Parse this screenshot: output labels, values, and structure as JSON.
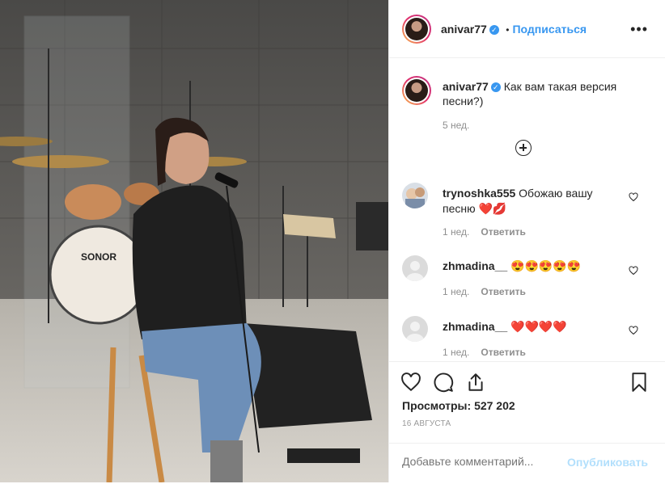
{
  "post": {
    "username": "anivar77",
    "follow_label": "Подписаться",
    "dot": "•",
    "more": "•••",
    "caption": "Как вам такая версия песни?)",
    "caption_time": "5 нед.",
    "drum_brand": "SONOR"
  },
  "comments": [
    {
      "user": "trynoshka555",
      "text": "Обожаю вашу песню",
      "emoji": "❤️💋",
      "time": "1 нед.",
      "reply": "Ответить"
    },
    {
      "user": "zhmadina__",
      "text": "",
      "emoji": "😍😍😍😍😍",
      "time": "1 нед.",
      "reply": "Ответить"
    },
    {
      "user": "zhmadina__",
      "text": "",
      "emoji": "❤️❤️❤️❤️",
      "time": "1 нед.",
      "reply": "Ответить"
    }
  ],
  "stats": {
    "views_label": "Просмотры:",
    "views_value": "527 202",
    "date": "16 АВГУСТА"
  },
  "add_comment": {
    "placeholder": "Добавьте комментарий...",
    "publish": "Опубликовать"
  },
  "colors": {
    "accent": "#3897f0",
    "text": "#262626",
    "muted": "#8e8e8e",
    "heart": "#ed4956"
  }
}
